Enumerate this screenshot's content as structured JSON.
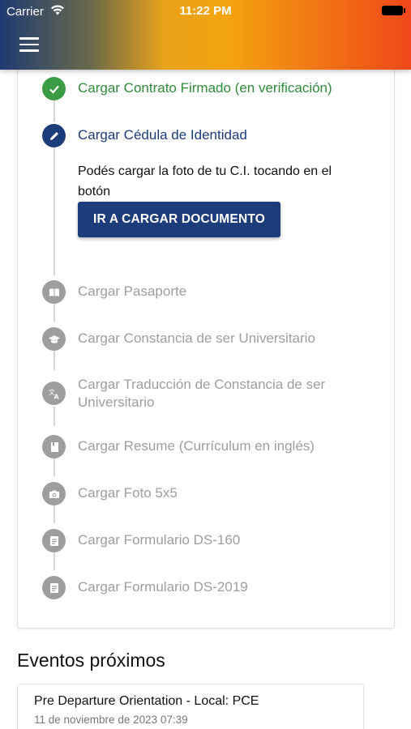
{
  "status_bar": {
    "carrier": "Carrier",
    "time": "11:22 PM"
  },
  "colors": {
    "done": "#3c9b45",
    "active": "#1d3c7a",
    "pending": "#9e9e9e"
  },
  "steps": [
    {
      "label": "Cargar Contrato Firmado (en verificación)",
      "state": "done",
      "icon": "check-icon"
    },
    {
      "label": "Cargar Cédula de Identidad",
      "state": "active",
      "icon": "pencil-icon",
      "description": "Podés cargar la foto de tu C.I. tocando en el botón",
      "button_label": "IR A CARGAR DOCUMENTO"
    },
    {
      "label": "Cargar Pasaporte",
      "state": "pending",
      "icon": "book-icon"
    },
    {
      "label": "Cargar Constancia de ser Universitario",
      "state": "pending",
      "icon": "graduation-cap-icon"
    },
    {
      "label": "Cargar Traducción de Constancia de ser Universitario",
      "state": "pending",
      "icon": "translate-icon"
    },
    {
      "label": "Cargar Resume (Currículum en inglés)",
      "state": "pending",
      "icon": "bookmark-book-icon"
    },
    {
      "label": "Cargar Foto 5x5",
      "state": "pending",
      "icon": "camera-icon"
    },
    {
      "label": "Cargar Formulario DS-160",
      "state": "pending",
      "icon": "document-icon"
    },
    {
      "label": "Cargar Formulario DS-2019",
      "state": "pending",
      "icon": "document-icon"
    }
  ],
  "events": {
    "title": "Eventos próximos",
    "items": [
      {
        "title": "Pre Departure Orientation - Local: PCE",
        "date": "11 de noviembre de 2023 07:39"
      }
    ]
  }
}
